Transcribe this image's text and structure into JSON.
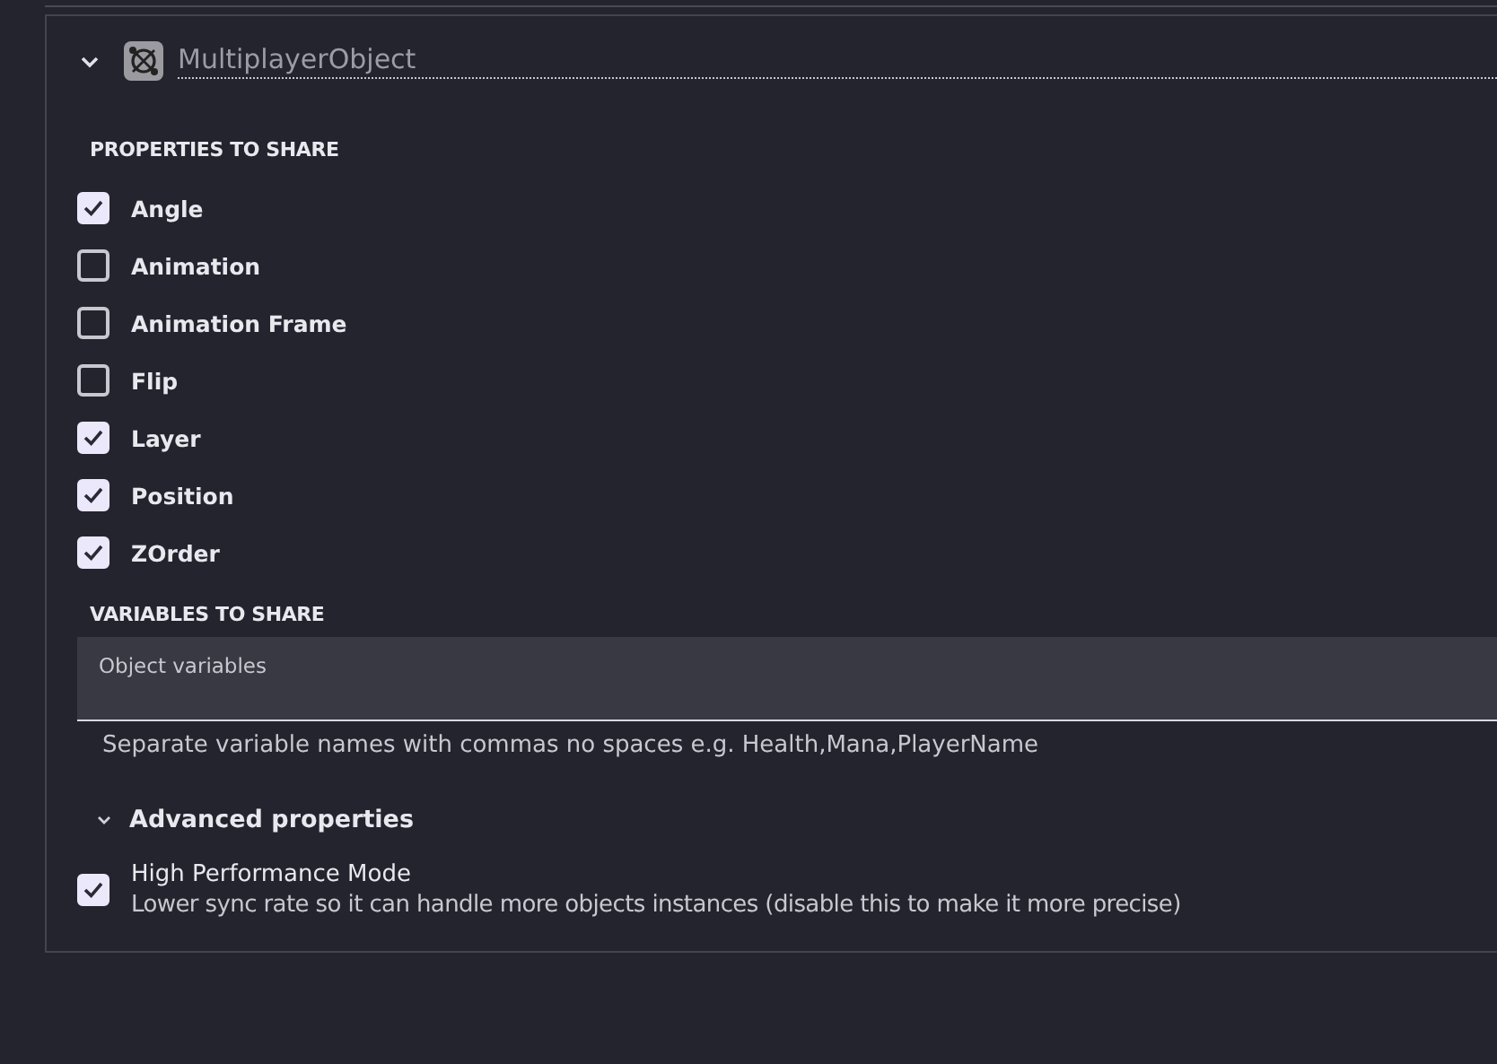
{
  "behavior": {
    "name": "MultiplayerObject",
    "expanded": true
  },
  "properties_heading": "PROPERTIES TO SHARE",
  "properties": [
    {
      "label": "Angle",
      "checked": true
    },
    {
      "label": "Animation",
      "checked": false
    },
    {
      "label": "Animation Frame",
      "checked": false
    },
    {
      "label": "Flip",
      "checked": false
    },
    {
      "label": "Layer",
      "checked": true
    },
    {
      "label": "Position",
      "checked": true
    },
    {
      "label": "ZOrder",
      "checked": true
    }
  ],
  "variables_heading": "VARIABLES TO SHARE",
  "variables_field": {
    "label": "Object variables",
    "helper": "Separate variable names with commas no spaces e.g. Health,Mana,PlayerName"
  },
  "advanced": {
    "label": "Advanced properties",
    "expanded": true,
    "options": [
      {
        "label": "High Performance Mode",
        "description": "Lower sync rate so it can handle more objects instances (disable this to make it more precise)",
        "checked": true
      }
    ]
  }
}
